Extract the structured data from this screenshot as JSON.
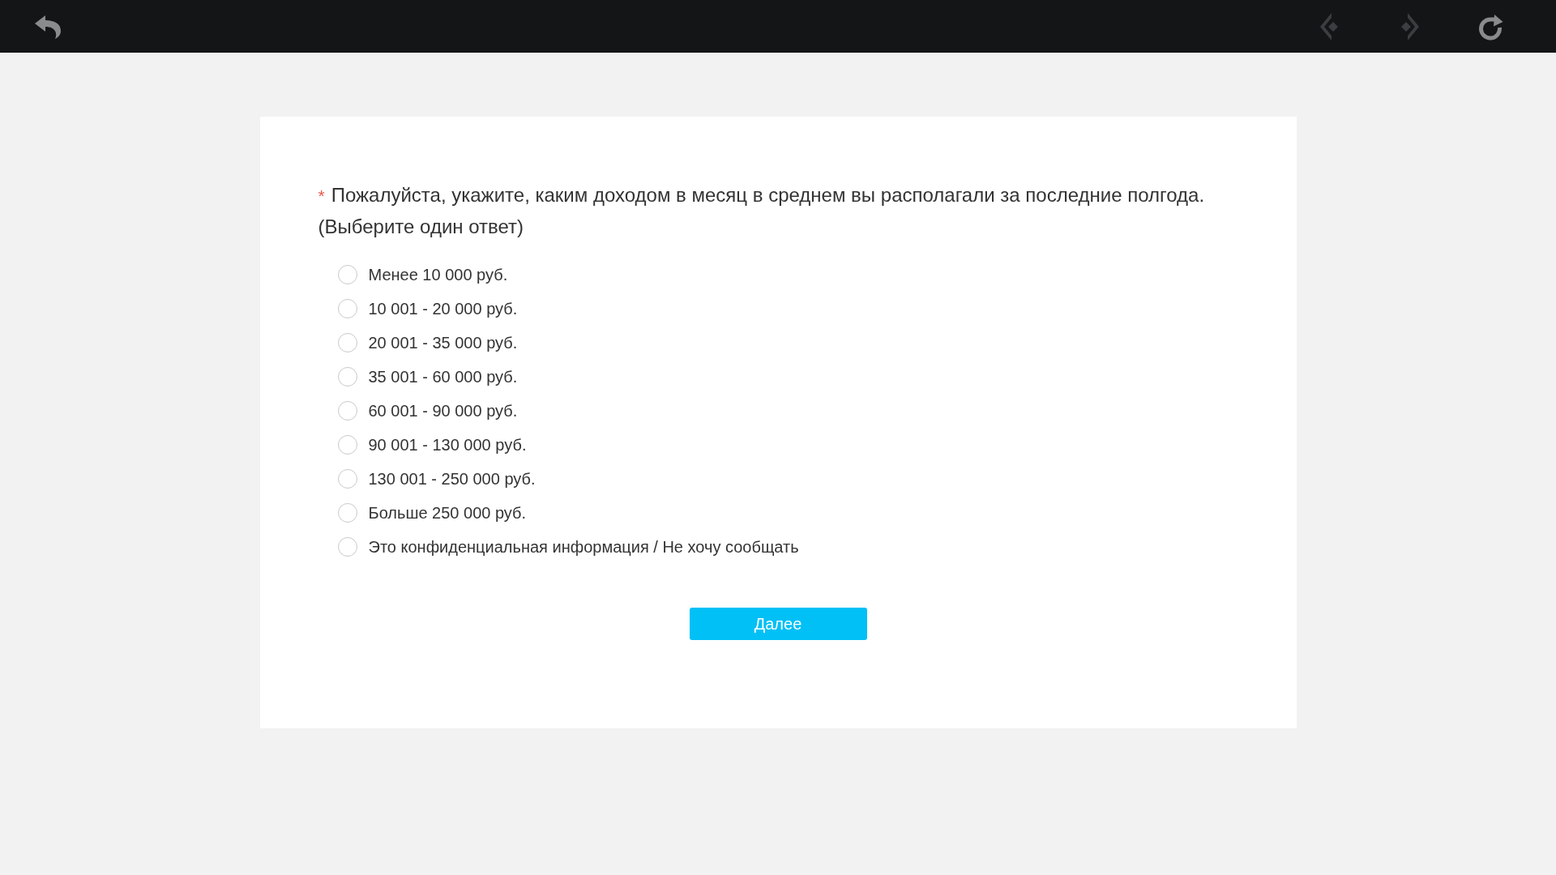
{
  "toolbar": {
    "buttons": [
      {
        "kind": "back",
        "disabled": false
      },
      {
        "kind": "previous",
        "disabled": true
      },
      {
        "kind": "next",
        "disabled": true
      },
      {
        "kind": "reload",
        "disabled": false
      }
    ]
  },
  "question": {
    "required_mark": "*",
    "text": "Пожалуйста, укажите, каким доходом в месяц в среднем вы располагали за последние полгода.",
    "hint": "(Выберите один ответ)"
  },
  "options": [
    {
      "label": "Менее 10 000 руб.",
      "selected": false
    },
    {
      "label": "10 001 - 20 000 руб.",
      "selected": false
    },
    {
      "label": "20 001 - 35 000 руб.",
      "selected": false
    },
    {
      "label": "35 001 - 60 000 руб.",
      "selected": false
    },
    {
      "label": "60 001 - 90 000 руб.",
      "selected": false
    },
    {
      "label": "90 001 - 130 000 руб.",
      "selected": false
    },
    {
      "label": "130 001 - 250 000 руб.",
      "selected": false
    },
    {
      "label": "Больше 250 000 руб.",
      "selected": false
    },
    {
      "label": "Это конфиденциальная информация / Не хочу сообщать",
      "selected": false
    }
  ],
  "next_button": {
    "label": "Далее"
  }
}
